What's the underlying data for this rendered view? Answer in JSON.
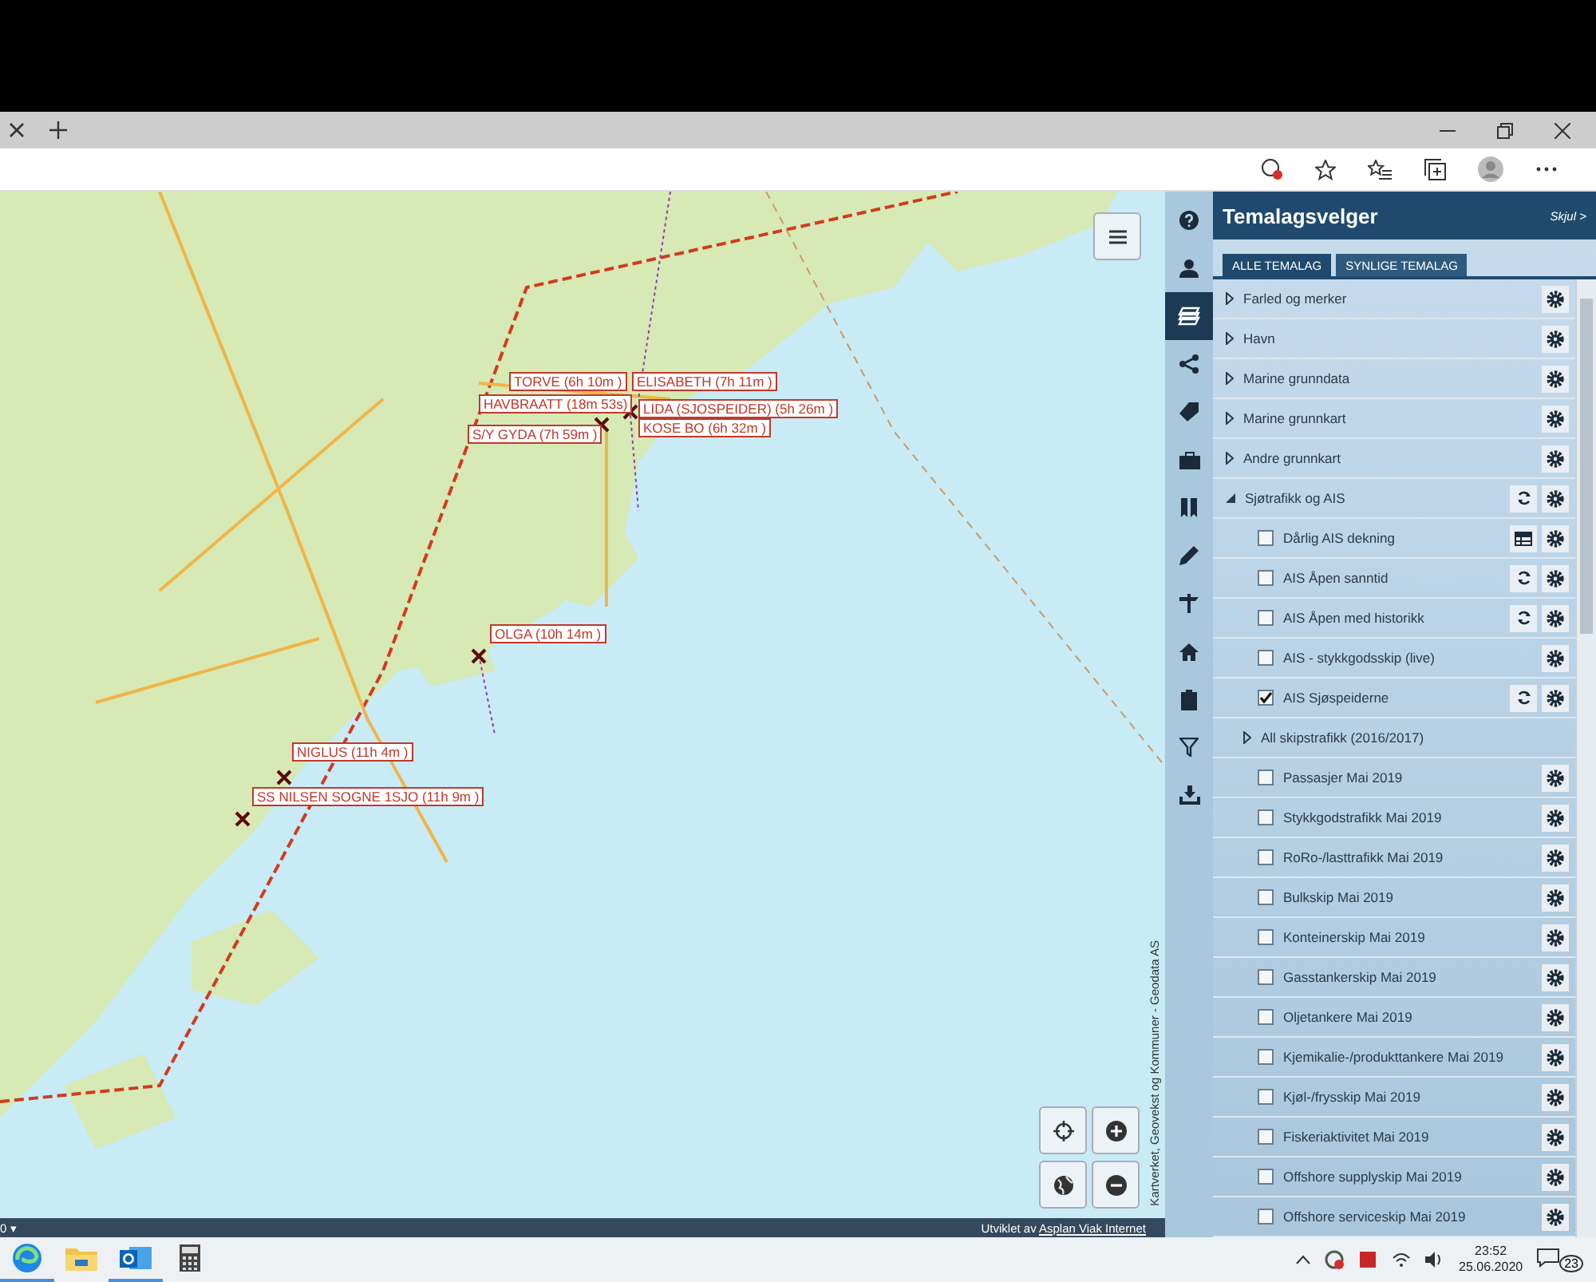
{
  "map": {
    "vessels": [
      {
        "label": "TORVE (6h 10m )"
      },
      {
        "label": "ELISABETH (7h 11m )"
      },
      {
        "label": "HAVBRAATT (18m 53s)"
      },
      {
        "label": "LIDA (SJOSPEIDER) (5h 26m )"
      },
      {
        "label": "S/Y GYDA (7h 59m )"
      },
      {
        "label": "KOSE BO (6h 32m )"
      },
      {
        "label": "OLGA (10h 14m )"
      },
      {
        "label": "NIGLUS (11h 4m )"
      },
      {
        "label": "SS NILSEN SOGNE 1SJO (11h 9m )"
      }
    ],
    "attribution": "Kartverket, Geovekst og Kommuner - Geodata AS",
    "scale_menu": "0 ▾",
    "credit_prefix": "Utviklet av",
    "credit_link": "Asplan Viak Internet"
  },
  "sidebar": {
    "items": [
      {
        "selected": false
      },
      {
        "selected": false
      },
      {
        "selected": true
      },
      {
        "selected": false
      },
      {
        "selected": false
      },
      {
        "selected": false
      },
      {
        "selected": false
      },
      {
        "selected": false
      },
      {
        "selected": false
      },
      {
        "selected": false
      },
      {
        "selected": false
      },
      {
        "selected": false
      },
      {
        "selected": false
      }
    ]
  },
  "panel": {
    "title": "Temalagsvelger",
    "hide_link": "Skjul >",
    "tabs": [
      {
        "label": "ALLE TEMALAG",
        "selected": true
      },
      {
        "label": "SYNLIGE TEMALAG",
        "selected": false
      }
    ],
    "layers": [
      {
        "kind": "group",
        "label": "Farled og merker",
        "expanded": false,
        "settings": true
      },
      {
        "kind": "group",
        "label": "Havn",
        "expanded": false,
        "settings": true
      },
      {
        "kind": "group",
        "label": "Marine grunndata",
        "expanded": false,
        "settings": true
      },
      {
        "kind": "group",
        "label": "Marine grunnkart",
        "expanded": false,
        "settings": true
      },
      {
        "kind": "group",
        "label": "Andre grunnkart",
        "expanded": false,
        "settings": true
      },
      {
        "kind": "group",
        "label": "Sjøtrafikk og AIS",
        "expanded": true,
        "refresh": true,
        "settings": true,
        "children": [
          {
            "kind": "layer",
            "label": "Dårlig AIS dekning",
            "checked": false,
            "table": true,
            "settings": true
          },
          {
            "kind": "layer",
            "label": "AIS Åpen sanntid",
            "checked": false,
            "refresh": true,
            "settings": true
          },
          {
            "kind": "layer",
            "label": "AIS Åpen med historikk",
            "checked": false,
            "refresh": true,
            "settings": true
          },
          {
            "kind": "layer",
            "label": "AIS - stykkgodsskip (live)",
            "checked": false,
            "settings": true
          },
          {
            "kind": "layer",
            "label": "AIS Sjøspeiderne",
            "checked": true,
            "refresh": true,
            "settings": true
          },
          {
            "kind": "group",
            "label": "All skipstrafikk (2016/2017)",
            "expanded": false
          },
          {
            "kind": "layer",
            "label": "Passasjer Mai 2019",
            "checked": false,
            "settings": true
          },
          {
            "kind": "layer",
            "label": "Stykkgodstrafikk Mai 2019",
            "checked": false,
            "settings": true
          },
          {
            "kind": "layer",
            "label": "RoRo-/lasttrafikk Mai 2019",
            "checked": false,
            "settings": true
          },
          {
            "kind": "layer",
            "label": "Bulkskip Mai 2019",
            "checked": false,
            "settings": true
          },
          {
            "kind": "layer",
            "label": "Konteinerskip Mai 2019",
            "checked": false,
            "settings": true
          },
          {
            "kind": "layer",
            "label": "Gasstankerskip Mai 2019",
            "checked": false,
            "settings": true
          },
          {
            "kind": "layer",
            "label": "Oljetankere Mai 2019",
            "checked": false,
            "settings": true
          },
          {
            "kind": "layer",
            "label": "Kjemikalie-/produkttankere Mai 2019",
            "checked": false,
            "settings": true
          },
          {
            "kind": "layer",
            "label": "Kjøl-/frysskip Mai 2019",
            "checked": false,
            "settings": true
          },
          {
            "kind": "layer",
            "label": "Fiskeriaktivitet Mai 2019",
            "checked": false,
            "settings": true
          },
          {
            "kind": "layer",
            "label": "Offshore supplyskip Mai 2019",
            "checked": false,
            "settings": true
          },
          {
            "kind": "layer",
            "label": "Offshore serviceskip Mai 2019",
            "checked": false,
            "settings": true
          }
        ]
      }
    ]
  },
  "taskbar": {
    "apps": [
      {
        "running": true
      },
      {
        "running": false
      },
      {
        "running": true
      },
      {
        "running": false
      }
    ],
    "time": "23:52",
    "date": "25.06.2020",
    "notifications": "23"
  }
}
